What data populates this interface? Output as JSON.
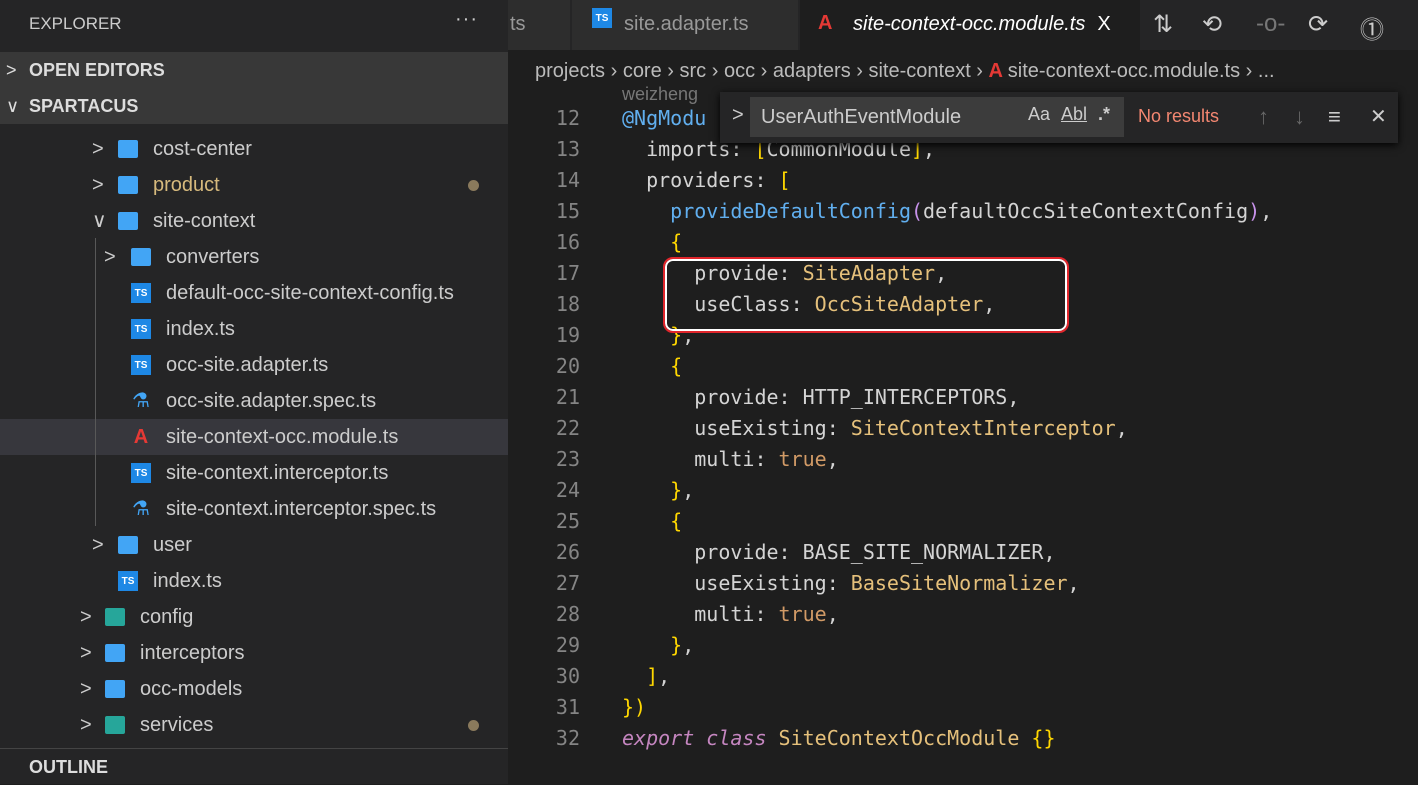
{
  "sidebar": {
    "title": "EXPLORER",
    "more": "···",
    "sections": {
      "open_editors": "OPEN EDITORS",
      "spartacus": "SPARTACUS"
    },
    "tree": [
      {
        "label": "cost-center",
        "type": "folder",
        "expanded": false
      },
      {
        "label": "product",
        "type": "folder",
        "expanded": false,
        "modified": true
      },
      {
        "label": "site-context",
        "type": "folder",
        "expanded": true
      },
      {
        "label": "converters",
        "type": "folder",
        "expanded": false
      },
      {
        "label": "default-occ-site-context-config.ts",
        "type": "ts"
      },
      {
        "label": "index.ts",
        "type": "ts"
      },
      {
        "label": "occ-site.adapter.ts",
        "type": "ts"
      },
      {
        "label": "occ-site.adapter.spec.ts",
        "type": "spec"
      },
      {
        "label": "site-context-occ.module.ts",
        "type": "angular",
        "selected": true
      },
      {
        "label": "site-context.interceptor.ts",
        "type": "ts"
      },
      {
        "label": "site-context.interceptor.spec.ts",
        "type": "spec"
      },
      {
        "label": "user",
        "type": "folder",
        "expanded": false
      },
      {
        "label": "index.ts",
        "type": "ts"
      },
      {
        "label": "config",
        "type": "folder-config",
        "expanded": false
      },
      {
        "label": "interceptors",
        "type": "folder",
        "expanded": false
      },
      {
        "label": "occ-models",
        "type": "folder",
        "expanded": false
      },
      {
        "label": "services",
        "type": "folder-services",
        "expanded": false,
        "modified": true
      }
    ],
    "outline": "OUTLINE"
  },
  "tabs": [
    {
      "label": "ts"
    },
    {
      "label": "site.adapter.ts",
      "icon": "ts"
    },
    {
      "label": "site-context-occ.module.ts",
      "icon": "angular",
      "active": true,
      "close": "X"
    }
  ],
  "breadcrumb": [
    "projects",
    "core",
    "src",
    "occ",
    "adapters",
    "site-context",
    "site-context-occ.module.ts",
    "..."
  ],
  "find": {
    "value": "UserAuthEventModule",
    "match_case": "Aa",
    "whole_word": "Abl",
    "regex": ".*",
    "status": "No results"
  },
  "codelens": "weizheng",
  "code": [
    {
      "n": "12",
      "t": [
        [
          "@NgModu",
          "f"
        ]
      ]
    },
    {
      "n": "13",
      "t": [
        [
          "  imports: ",
          ""
        ],
        [
          "[",
          "b"
        ],
        [
          "CommonModule",
          ""
        ],
        [
          "]",
          "b"
        ],
        [
          ",",
          ""
        ]
      ]
    },
    {
      "n": "14",
      "t": [
        [
          "  providers: ",
          ""
        ],
        [
          "[",
          "b"
        ]
      ]
    },
    {
      "n": "15",
      "t": [
        [
          "    provideDefaultConfig",
          "f"
        ],
        [
          "(",
          "p"
        ],
        [
          "defaultOccSiteContextConfig",
          ""
        ],
        [
          ")",
          "p"
        ],
        [
          ",",
          ""
        ]
      ]
    },
    {
      "n": "16",
      "t": [
        [
          "    {",
          "b"
        ]
      ]
    },
    {
      "n": "17",
      "t": [
        [
          "      provide: ",
          ""
        ],
        [
          "SiteAdapter",
          "c"
        ],
        [
          ",",
          ""
        ]
      ]
    },
    {
      "n": "18",
      "t": [
        [
          "      useClass: ",
          ""
        ],
        [
          "OccSiteAdapter",
          "c"
        ],
        [
          ",",
          ""
        ]
      ]
    },
    {
      "n": "19",
      "t": [
        [
          "    }",
          "b"
        ],
        [
          ",",
          ""
        ]
      ]
    },
    {
      "n": "20",
      "t": [
        [
          "    {",
          "b"
        ]
      ]
    },
    {
      "n": "21",
      "t": [
        [
          "      provide: ",
          ""
        ],
        [
          "HTTP_INTERCEPTORS",
          ""
        ],
        [
          ",",
          ""
        ]
      ]
    },
    {
      "n": "22",
      "t": [
        [
          "      useExisting: ",
          ""
        ],
        [
          "SiteContextInterceptor",
          "c"
        ],
        [
          ",",
          ""
        ]
      ]
    },
    {
      "n": "23",
      "t": [
        [
          "      multi: ",
          ""
        ],
        [
          "true",
          "t"
        ],
        [
          ",",
          ""
        ]
      ]
    },
    {
      "n": "24",
      "t": [
        [
          "    }",
          "b"
        ],
        [
          ",",
          ""
        ]
      ]
    },
    {
      "n": "25",
      "t": [
        [
          "    {",
          "b"
        ]
      ]
    },
    {
      "n": "26",
      "t": [
        [
          "      provide: ",
          ""
        ],
        [
          "BASE_SITE_NORMALIZER",
          ""
        ],
        [
          ",",
          ""
        ]
      ]
    },
    {
      "n": "27",
      "t": [
        [
          "      useExisting: ",
          ""
        ],
        [
          "BaseSiteNormalizer",
          "c"
        ],
        [
          ",",
          ""
        ]
      ]
    },
    {
      "n": "28",
      "t": [
        [
          "      multi: ",
          ""
        ],
        [
          "true",
          "t"
        ],
        [
          ",",
          ""
        ]
      ]
    },
    {
      "n": "29",
      "t": [
        [
          "    }",
          "b"
        ],
        [
          ",",
          ""
        ]
      ]
    },
    {
      "n": "30",
      "t": [
        [
          "  ]",
          "b"
        ],
        [
          ",",
          ""
        ]
      ]
    },
    {
      "n": "31",
      "t": [
        [
          "}",
          "b"
        ],
        [
          ")",
          "b"
        ]
      ]
    },
    {
      "n": "32",
      "t": [
        [
          "export class ",
          "k"
        ],
        [
          "SiteContextOccModule ",
          "c"
        ],
        [
          "{}",
          "b"
        ]
      ]
    }
  ],
  "colors": {
    "highlight": "#e0252b",
    "no_results": "#f48771"
  }
}
